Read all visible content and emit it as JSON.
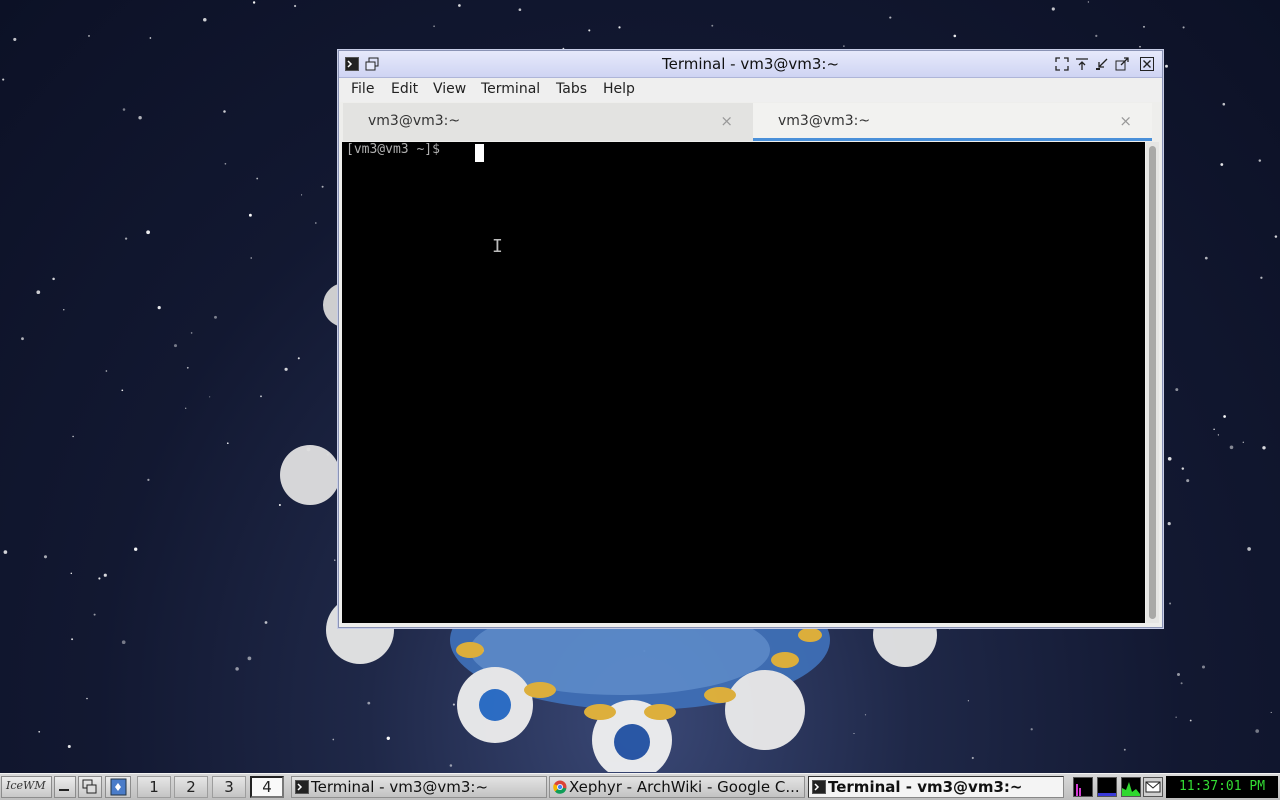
{
  "window": {
    "title": "Terminal - vm3@vm3:~",
    "menu": [
      "File",
      "Edit",
      "View",
      "Terminal",
      "Tabs",
      "Help"
    ],
    "tabs": [
      {
        "label": "vm3@vm3:~",
        "close": "×",
        "active": false
      },
      {
        "label": "vm3@vm3:~",
        "close": "×",
        "active": true
      }
    ],
    "terminal": {
      "prompt": "[vm3@vm3 ~]$ ",
      "background": "#000000",
      "text_color": "#b0b0b0"
    }
  },
  "taskbar": {
    "start_label": "IceWM",
    "workspaces": [
      "1",
      "2",
      "3",
      "4"
    ],
    "active_workspace": "4",
    "tasks": [
      {
        "label": "Terminal - vm3@vm3:~",
        "icon": "terminal-icon",
        "active": false
      },
      {
        "label": "Xephyr - ArchWiki - Google C...",
        "icon": "chrome-icon",
        "active": false
      },
      {
        "label": "Terminal - vm3@vm3:~",
        "icon": "terminal-icon",
        "active": true
      }
    ],
    "clock": "11:37:01 PM",
    "clock_color": "#33dd33"
  },
  "colors": {
    "titlebar": "#d8dcf6",
    "tab_underline": "#4a90d9",
    "desktop": "#121831"
  }
}
